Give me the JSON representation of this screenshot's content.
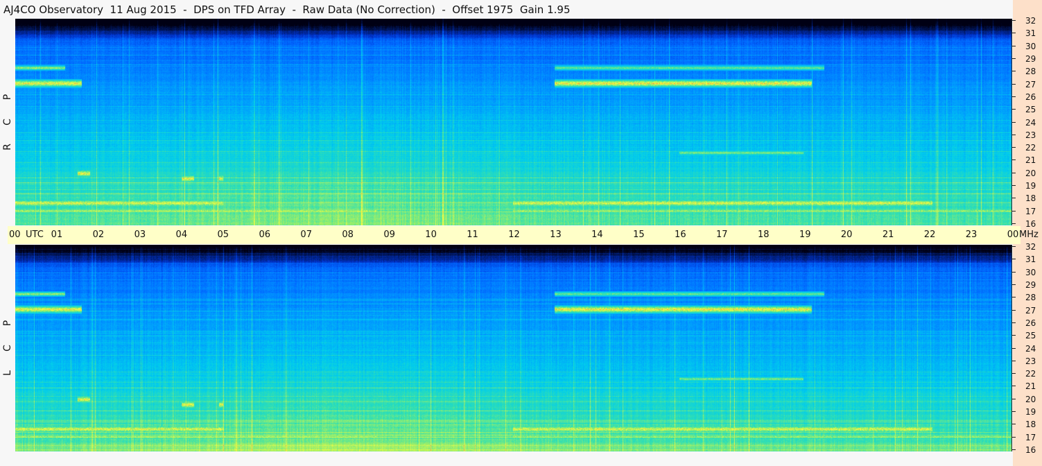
{
  "title": "AJ4CO Observatory  11 Aug 2015  -  DPS on TFD Array  -  Raw Data (No Correction)  -  Offset 1975  Gain 1.95",
  "panels": [
    {
      "polarization": [
        "R",
        "C",
        "P"
      ]
    },
    {
      "polarization": [
        "L",
        "C",
        "P"
      ]
    }
  ],
  "time_axis": {
    "utc_label": "UTC",
    "unit_label": "MHz",
    "ticks": [
      "00",
      "01",
      "02",
      "03",
      "04",
      "05",
      "06",
      "07",
      "08",
      "09",
      "10",
      "11",
      "12",
      "13",
      "14",
      "15",
      "16",
      "17",
      "18",
      "19",
      "20",
      "21",
      "22",
      "23",
      "00"
    ]
  },
  "freq_axis": {
    "ticks": [
      "32",
      "31",
      "30",
      "29",
      "28",
      "27",
      "26",
      "25",
      "24",
      "23",
      "22",
      "21",
      "20",
      "19",
      "18",
      "17",
      "16"
    ]
  },
  "colors": {
    "right_strip": "#fde0c9",
    "time_bar": "#ffffc8",
    "colormap": [
      "#000014",
      "#001a66",
      "#0033cc",
      "#0066ff",
      "#0099ff",
      "#00ccee",
      "#33e0b0",
      "#a8f060",
      "#ffff40",
      "#ff8040",
      "#ff2080"
    ]
  },
  "chart_data": {
    "type": "heatmap",
    "title": "AJ4CO Observatory  11 Aug 2015  -  DPS on TFD Array  -  Raw Data (No Correction)  -  Offset 1975  Gain 1.95",
    "x_range_utc_hours": [
      0,
      24
    ],
    "y_range_mhz": [
      16,
      32
    ],
    "panels": [
      "RCP",
      "LCP"
    ],
    "emission_bands": [
      {
        "freq_mhz": 27.0,
        "utc_start": 0.0,
        "utc_end": 1.6,
        "intensity": 0.9
      },
      {
        "freq_mhz": 27.0,
        "utc_start": 13.0,
        "utc_end": 19.2,
        "intensity": 0.95
      },
      {
        "freq_mhz": 28.2,
        "utc_start": 0.0,
        "utc_end": 1.2,
        "intensity": 0.7
      },
      {
        "freq_mhz": 28.2,
        "utc_start": 13.0,
        "utc_end": 19.5,
        "intensity": 0.55
      },
      {
        "freq_mhz": 17.7,
        "utc_start": 0.0,
        "utc_end": 5.0,
        "intensity": 0.85
      },
      {
        "freq_mhz": 17.7,
        "utc_start": 12.0,
        "utc_end": 22.1,
        "intensity": 0.85
      },
      {
        "freq_mhz": 17.1,
        "utc_start": 0.0,
        "utc_end": 8.7,
        "intensity": 0.75
      },
      {
        "freq_mhz": 17.1,
        "utc_start": 12.0,
        "utc_end": 24.0,
        "intensity": 0.7
      },
      {
        "freq_mhz": 21.6,
        "utc_start": 16.0,
        "utc_end": 19.0,
        "intensity": 0.6
      },
      {
        "freq_mhz": 20.0,
        "utc_start": 1.5,
        "utc_end": 1.8,
        "intensity": 0.9
      },
      {
        "freq_mhz": 19.6,
        "utc_start": 4.0,
        "utc_end": 4.3,
        "intensity": 0.9
      },
      {
        "freq_mhz": 19.6,
        "utc_start": 4.9,
        "utc_end": 5.0,
        "intensity": 0.9
      }
    ]
  }
}
